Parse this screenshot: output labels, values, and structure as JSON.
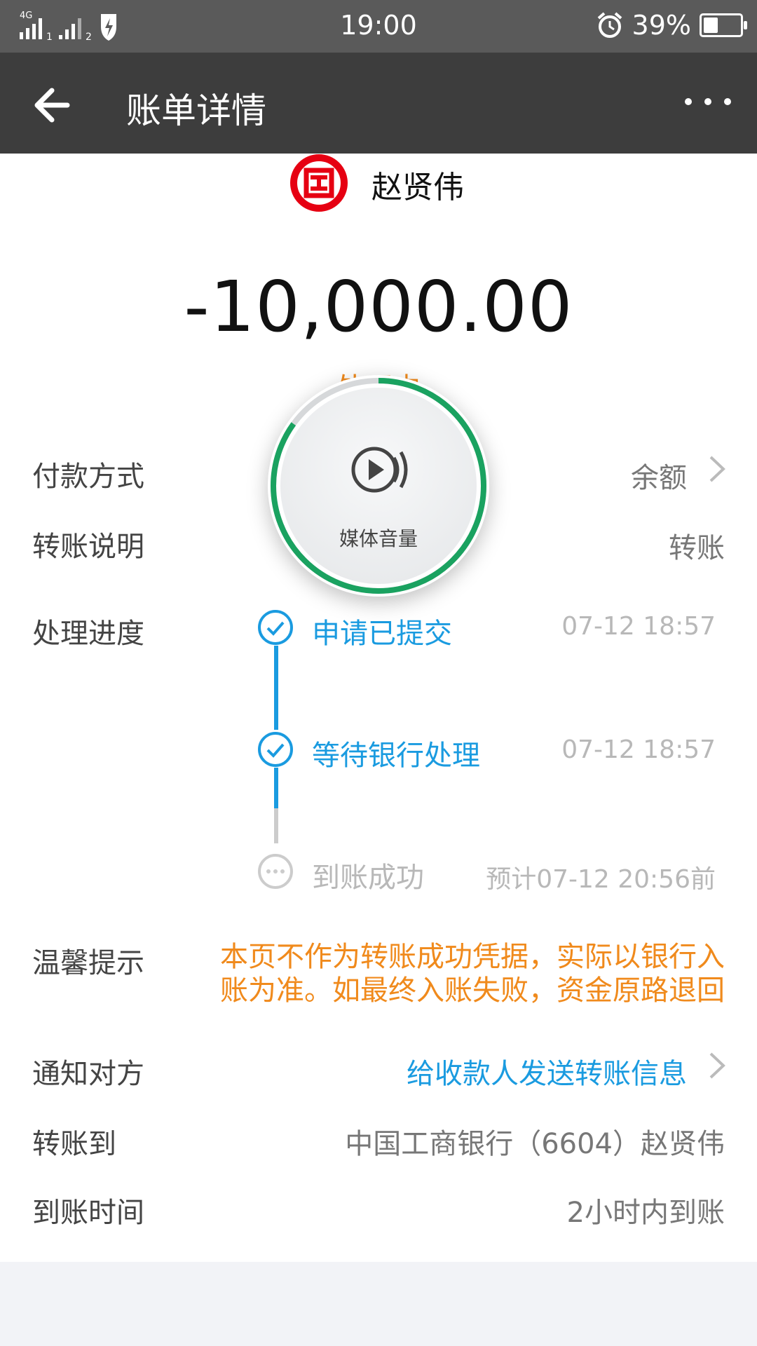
{
  "status_bar": {
    "time": "19:00",
    "battery": "39%",
    "battery_level": 0.39
  },
  "header": {
    "title": "账单详情"
  },
  "payee": {
    "name": "赵贤伟"
  },
  "amount": "-10,000.00",
  "status_text": "处理中",
  "rows": {
    "payment_method": {
      "label": "付款方式",
      "value": "余额"
    },
    "transfer_note": {
      "label": "转账说明",
      "value": "转账"
    },
    "progress": {
      "label": "处理进度"
    },
    "tip": {
      "label": "温馨提示",
      "value": "本页不作为转账成功凭据，实际以银行入账为准。如最终入账失败，资金原路退回"
    },
    "notify": {
      "label": "通知对方",
      "value": "给收款人发送转账信息"
    },
    "transfer_to": {
      "label": "转账到",
      "value": "中国工商银行（6604）赵贤伟"
    },
    "arrival_time": {
      "label": "到账时间",
      "value": "2小时内到账"
    }
  },
  "steps": [
    {
      "label": "申请已提交",
      "time": "07-12 18:57"
    },
    {
      "label": "等待银行处理",
      "time": "07-12 18:57"
    },
    {
      "label": "到账成功",
      "time": "预计07-12 20:56前"
    }
  ],
  "volume": {
    "label": "媒体音量",
    "level": 0.85
  },
  "colors": {
    "accent_blue": "#1a9be0",
    "orange": "#f08a1c",
    "green": "#1aa260",
    "bank_red": "#e60012"
  }
}
